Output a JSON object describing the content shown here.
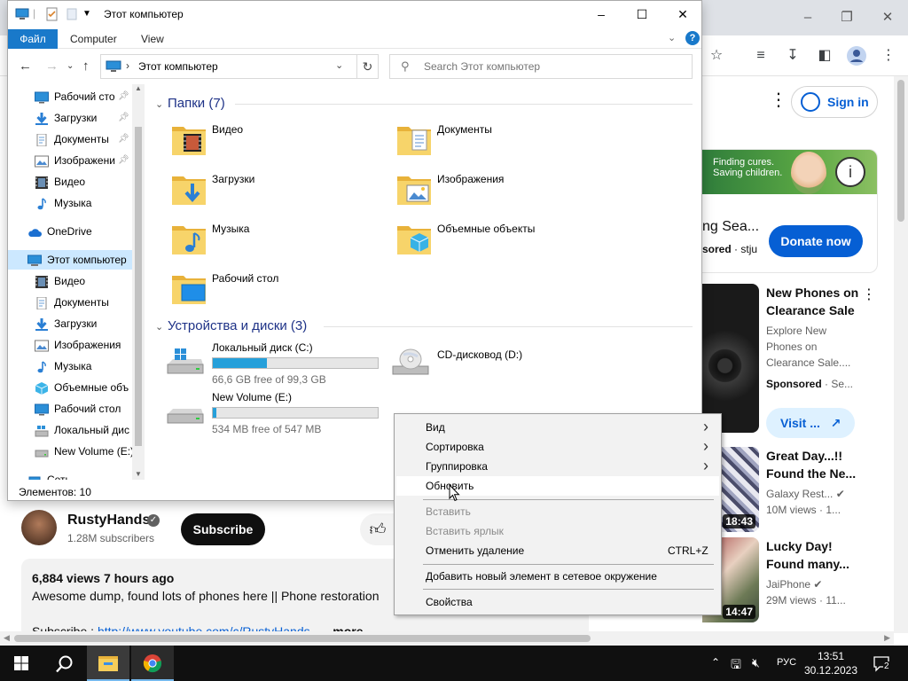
{
  "explorer": {
    "title": "Этот компьютер",
    "ribbon_tabs": {
      "file": "Файл",
      "computer": "Computer",
      "view": "View"
    },
    "address": "Этот компьютер",
    "search_placeholder": "Search Этот компьютер",
    "nav": [
      {
        "label": "Рабочий сто",
        "icon": "desktop-icon",
        "pinned": true
      },
      {
        "label": "Загрузки",
        "icon": "downloads-icon",
        "pinned": true
      },
      {
        "label": "Документы",
        "icon": "documents-icon",
        "pinned": true
      },
      {
        "label": "Изображени",
        "icon": "pictures-icon",
        "pinned": true
      },
      {
        "label": "Видео",
        "icon": "videos-icon",
        "pinned": false
      },
      {
        "label": "Музыка",
        "icon": "music-icon",
        "pinned": false
      },
      {
        "label": "OneDrive",
        "icon": "onedrive-icon",
        "pinned": false
      },
      {
        "label": "Этот компьютер",
        "icon": "this-pc-icon",
        "pinned": false
      },
      {
        "label": "Видео",
        "icon": "videos-icon",
        "pinned": false
      },
      {
        "label": "Документы",
        "icon": "documents-icon",
        "pinned": false
      },
      {
        "label": "Загрузки",
        "icon": "downloads-icon",
        "pinned": false
      },
      {
        "label": "Изображения",
        "icon": "pictures-icon",
        "pinned": false
      },
      {
        "label": "Музыка",
        "icon": "music-icon",
        "pinned": false
      },
      {
        "label": "Объемные объ",
        "icon": "3d-objects-icon",
        "pinned": false
      },
      {
        "label": "Рабочий стол",
        "icon": "desktop-icon",
        "pinned": false
      },
      {
        "label": "Локальный дис",
        "icon": "local-disk-icon",
        "pinned": false
      },
      {
        "label": "New Volume (E:)",
        "icon": "drive-icon",
        "pinned": false
      },
      {
        "label": "Сеть",
        "icon": "network-icon",
        "pinned": false
      }
    ],
    "folders_header": "Папки (7)",
    "folders": [
      {
        "label": "Видео",
        "icon": "videos-folder-icon"
      },
      {
        "label": "Документы",
        "icon": "documents-folder-icon"
      },
      {
        "label": "Загрузки",
        "icon": "downloads-folder-icon"
      },
      {
        "label": "Изображения",
        "icon": "pictures-folder-icon"
      },
      {
        "label": "Музыка",
        "icon": "music-folder-icon"
      },
      {
        "label": "Объемные объекты",
        "icon": "3d-objects-folder-icon"
      },
      {
        "label": "Рабочий стол",
        "icon": "desktop-folder-icon"
      }
    ],
    "drives_header": "Устройства и диски (3)",
    "drives": [
      {
        "label": "Локальный диск (C:)",
        "free_text": "66,6 GB free of 99,3 GB",
        "used_fraction": 0.33,
        "has_bar": true
      },
      {
        "label": "CD-дисковод (D:)",
        "free_text": "",
        "used_fraction": 0,
        "has_bar": false
      },
      {
        "label": "New Volume (E:)",
        "free_text": "534 MB free of 547 MB",
        "used_fraction": 0.024,
        "has_bar": true
      }
    ],
    "status": "Элементов: 10"
  },
  "context_menu": {
    "items": [
      {
        "label": "Вид",
        "submenu": true,
        "disabled": false,
        "shortcut": ""
      },
      {
        "label": "Сортировка",
        "submenu": true,
        "disabled": false,
        "shortcut": ""
      },
      {
        "label": "Группировка",
        "submenu": true,
        "disabled": false,
        "shortcut": ""
      },
      {
        "label": "Обновить",
        "submenu": false,
        "disabled": false,
        "shortcut": "",
        "hover": true
      },
      {
        "label": "Вставить",
        "submenu": false,
        "disabled": true,
        "shortcut": ""
      },
      {
        "label": "Вставить ярлык",
        "submenu": false,
        "disabled": true,
        "shortcut": ""
      },
      {
        "label": "Отменить удаление",
        "submenu": false,
        "disabled": false,
        "shortcut": "CTRL+Z"
      },
      {
        "label": "Добавить новый элемент в сетевое окружение",
        "submenu": false,
        "disabled": false,
        "shortcut": ""
      },
      {
        "label": "Свойства",
        "submenu": false,
        "disabled": false,
        "shortcut": ""
      }
    ]
  },
  "youtube": {
    "sign_in": "Sign in",
    "ad": {
      "banner_text": "Finding cures. Saving children.",
      "title": "ng Sea...",
      "sponsored": "sored",
      "sponsor_rest": "· stju",
      "donate": "Donate now"
    },
    "recs": [
      {
        "title": "New Phones on Clearance Sale",
        "desc": "Explore New Phones on Clearance Sale....",
        "sponsored": "Sponsored",
        "sponsor_rest": " · Se...",
        "visit": "Visit ..."
      },
      {
        "title": "Great Day...!! Found the Ne...",
        "channel": "Galaxy Rest...",
        "meta": "10M views · 1...",
        "duration": "18:43"
      },
      {
        "title": "Lucky Day! Found many...",
        "channel": "JaiPhone",
        "meta": "29M views · 11...",
        "duration": "14:47"
      }
    ],
    "channel": {
      "name": "RustyHands",
      "subs": "1.28M subscribers",
      "subscribe": "Subscribe"
    },
    "description": {
      "views": "6,884 views  7 hours ago",
      "text": "Awesome dump, found lots of phones here || Phone restoration",
      "subscribe_prefix": "Subscribe : ",
      "subscribe_link": "http://www.youtube.com/c/RustyHands",
      "more": "...more"
    }
  },
  "taskbar": {
    "time": "13:51",
    "date": "30.12.2023",
    "lang": "РУС",
    "notifications": "2"
  },
  "colors": {
    "accent_blue": "#1979ca",
    "drive_bar": "#26a0da",
    "yt_blue": "#065fd4",
    "taskbar": "#101010"
  }
}
